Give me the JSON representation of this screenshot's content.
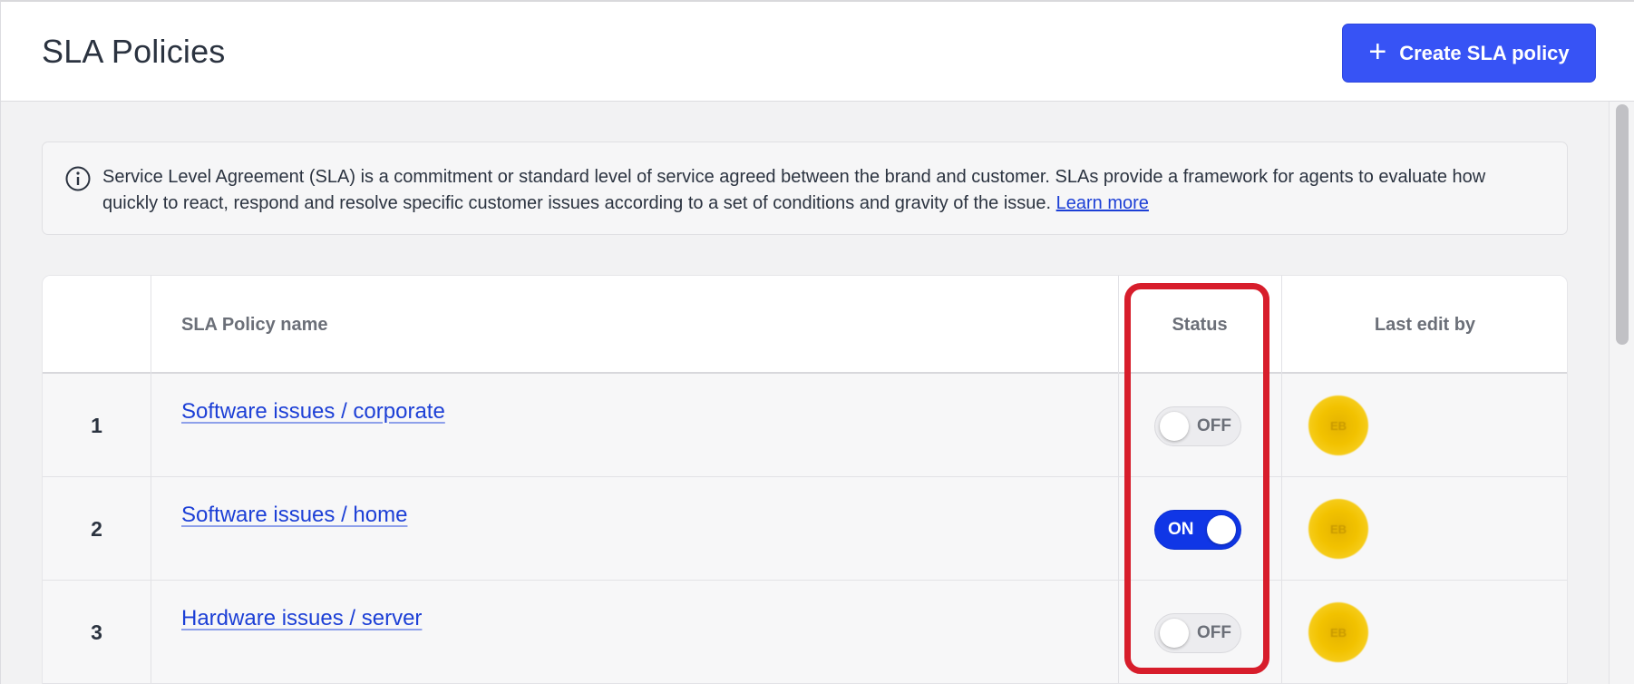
{
  "header": {
    "title": "SLA Policies",
    "create_button_label": "Create SLA policy"
  },
  "info": {
    "text": "Service Level Agreement (SLA) is a commitment or standard level of service agreed between the brand and customer. SLAs provide a framework for agents to evaluate how quickly to react, respond and resolve specific customer issues according to a set of conditions and gravity of the issue.",
    "link_label": "Learn more"
  },
  "table": {
    "columns": {
      "name": "SLA Policy name",
      "status": "Status",
      "last_edit": "Last edit by"
    },
    "rows": [
      {
        "index": "1",
        "name": "Software issues / corporate",
        "status": "OFF",
        "enabled": false,
        "avatar_initials": "EB"
      },
      {
        "index": "2",
        "name": "Software issues / home",
        "status": "ON",
        "enabled": true,
        "avatar_initials": "EB"
      },
      {
        "index": "3",
        "name": "Hardware issues / server",
        "status": "OFF",
        "enabled": false,
        "avatar_initials": "EB"
      }
    ]
  },
  "colors": {
    "primary_button": "#3753f5",
    "link": "#1c3fd6",
    "toggle_on": "#1036e6",
    "highlight_border": "#d71d2b",
    "avatar": "#f2c200"
  },
  "icons": {
    "create_button": "plus-icon",
    "info": "info-circle-icon"
  }
}
